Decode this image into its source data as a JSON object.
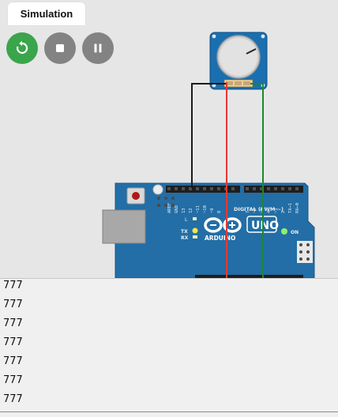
{
  "tab": {
    "label": "Simulation"
  },
  "controls": {
    "restart": "restart-icon",
    "stop": "stop-icon",
    "pause": "pause-icon",
    "restart_color": "#3aa54a",
    "button_color": "#838383"
  },
  "board": {
    "logo_text": "ARDUINO",
    "model": "UNO",
    "digital_label": "DIGITAL (PWM ~)",
    "on_label": "ON",
    "l_label": "L",
    "tx_label": "TX",
    "rx_label": "RX",
    "pin_labels": [
      "AREF",
      "GND",
      "13",
      "12",
      "~11",
      "~10",
      "~9",
      "8",
      "7",
      "~6",
      "~5",
      "4",
      "~3",
      "2",
      "TX→1",
      "RX←0"
    ]
  },
  "wires": {
    "gnd_color": "#1a1a1a",
    "vcc_color": "#e53935",
    "signal_color": "#1a8a2a"
  },
  "serial": {
    "lines": [
      "777",
      "777",
      "777",
      "777",
      "777",
      "777",
      "777"
    ]
  }
}
